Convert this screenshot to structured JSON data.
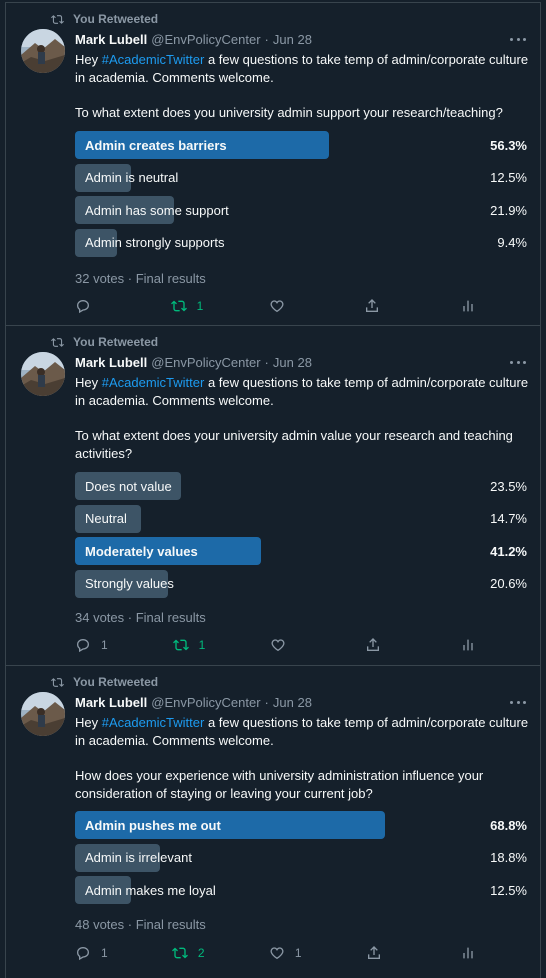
{
  "tweets": [
    {
      "retweet_label": "You Retweeted",
      "author_name": "Mark Lubell",
      "handle": "@EnvPolicyCenter",
      "separator": "·",
      "date": "Jun 28",
      "text_before": "Hey ",
      "hashtag": "#AcademicTwitter",
      "text_after": " a few questions to take temp of admin/corporate culture in academia.  Comments welcome.",
      "question": "To what extent does you university admin support your research/teaching?",
      "options": [
        {
          "label": "Admin creates barriers",
          "percent_text": "56.3%",
          "percent": 56.3,
          "winner": true
        },
        {
          "label": "Admin is neutral",
          "percent_text": "12.5%",
          "percent": 12.5,
          "winner": false
        },
        {
          "label": "Admin has some support",
          "percent_text": "21.9%",
          "percent": 21.9,
          "winner": false
        },
        {
          "label": "Admin strongly supports",
          "percent_text": "9.4%",
          "percent": 9.4,
          "winner": false
        }
      ],
      "votes_text": "32 votes · Final results",
      "reply_count": "",
      "retweet_count": "1",
      "like_count": ""
    },
    {
      "retweet_label": "You Retweeted",
      "author_name": "Mark Lubell",
      "handle": "@EnvPolicyCenter",
      "separator": "·",
      "date": "Jun 28",
      "text_before": "Hey ",
      "hashtag": "#AcademicTwitter",
      "text_after": " a few questions to take temp of admin/corporate culture in academia.  Comments welcome.",
      "question": "To what extent does your university admin value your research and teaching activities?",
      "options": [
        {
          "label": "Does not value",
          "percent_text": "23.5%",
          "percent": 23.5,
          "winner": false
        },
        {
          "label": "Neutral",
          "percent_text": "14.7%",
          "percent": 14.7,
          "winner": false
        },
        {
          "label": "Moderately values",
          "percent_text": "41.2%",
          "percent": 41.2,
          "winner": true
        },
        {
          "label": "Strongly values",
          "percent_text": "20.6%",
          "percent": 20.6,
          "winner": false
        }
      ],
      "votes_text": "34 votes · Final results",
      "reply_count": "1",
      "retweet_count": "1",
      "like_count": ""
    },
    {
      "retweet_label": "You Retweeted",
      "author_name": "Mark Lubell",
      "handle": "@EnvPolicyCenter",
      "separator": "·",
      "date": "Jun 28",
      "text_before": "Hey ",
      "hashtag": "#AcademicTwitter",
      "text_after": " a few questions to take temp of admin/corporate culture in academia.  Comments welcome.",
      "question": "How does your experience with university administration influence your consideration of staying or leaving your current job?",
      "options": [
        {
          "label": "Admin pushes me out",
          "percent_text": "68.8%",
          "percent": 68.8,
          "winner": true
        },
        {
          "label": "Admin is irrelevant",
          "percent_text": "18.8%",
          "percent": 18.8,
          "winner": false
        },
        {
          "label": "Admin makes me loyal",
          "percent_text": "12.5%",
          "percent": 12.5,
          "winner": false
        }
      ],
      "votes_text": "48 votes · Final results",
      "reply_count": "1",
      "retweet_count": "2",
      "like_count": "1"
    }
  ],
  "icons": {
    "retweet_header": "retweet-icon",
    "reply": "reply-icon",
    "retweet": "retweet-icon",
    "like": "heart-icon",
    "share": "share-icon",
    "analytics": "analytics-icon",
    "more": "more-icon"
  },
  "colors": {
    "background": "#15202b",
    "winner_bar": "#1d6aa8",
    "loser_bar": "#3d5466",
    "hashtag": "#1d9bf0",
    "retweeted": "#00ba7c",
    "muted": "#8b98a5"
  }
}
